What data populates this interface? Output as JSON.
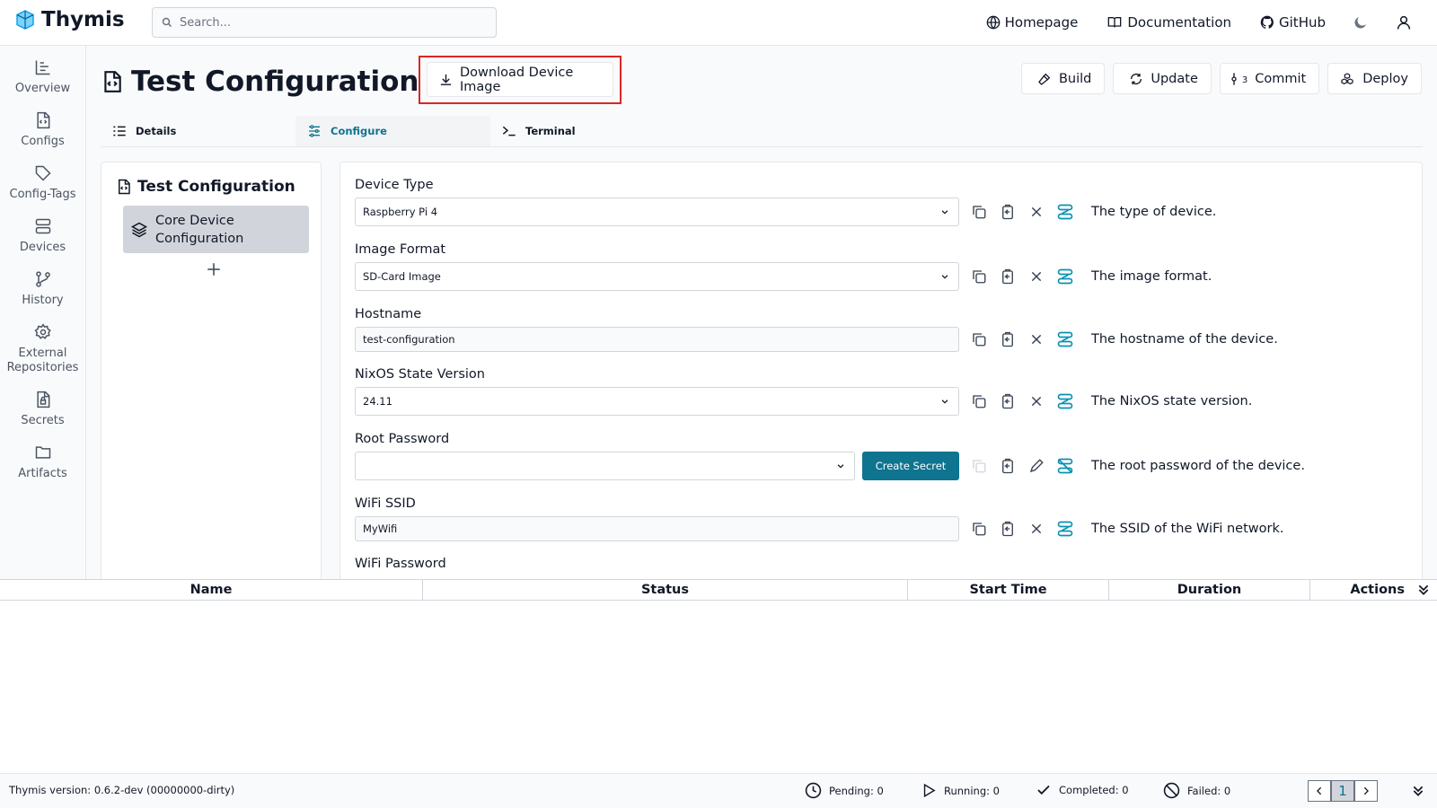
{
  "app": {
    "name": "Thymis"
  },
  "search": {
    "placeholder": "Search..."
  },
  "toplinks": {
    "homepage": "Homepage",
    "documentation": "Documentation",
    "github": "GitHub"
  },
  "sidebar": {
    "items": [
      {
        "label": "Overview",
        "icon": "bar-chart-icon"
      },
      {
        "label": "Configs",
        "icon": "file-code-icon"
      },
      {
        "label": "Config-Tags",
        "icon": "tag-icon"
      },
      {
        "label": "Devices",
        "icon": "server-icon"
      },
      {
        "label": "History",
        "icon": "git-branch-icon"
      },
      {
        "label": "External Repositories",
        "icon": "gear-icon"
      },
      {
        "label": "Secrets",
        "icon": "file-lock-icon"
      },
      {
        "label": "Artifacts",
        "icon": "folder-icon"
      }
    ]
  },
  "page": {
    "title": "Test Configuration",
    "download_label": "Download Device Image"
  },
  "actions": {
    "build": "Build",
    "update": "Update",
    "commit": "Commit",
    "commit_count": "3",
    "deploy": "Deploy"
  },
  "tabs": [
    {
      "label": "Details",
      "active": false
    },
    {
      "label": "Configure",
      "active": true
    },
    {
      "label": "Terminal",
      "active": false
    }
  ],
  "left_panel": {
    "title": "Test Configuration",
    "module": "Core Device Configuration"
  },
  "fields": [
    {
      "label": "Device Type",
      "value": "Raspberry Pi 4",
      "kind": "select",
      "description": "The type of device."
    },
    {
      "label": "Image Format",
      "value": "SD-Card Image",
      "kind": "select",
      "description": "The image format."
    },
    {
      "label": "Hostname",
      "value": "test-configuration",
      "kind": "text",
      "description": "The hostname of the device."
    },
    {
      "label": "NixOS State Version",
      "value": "24.11",
      "kind": "select",
      "description": "The NixOS state version."
    },
    {
      "label": "Root Password",
      "value": "",
      "kind": "secret",
      "button": "Create Secret",
      "description": "The root password of the device."
    },
    {
      "label": "WiFi SSID",
      "value": "MyWifi",
      "kind": "text",
      "description": "The SSID of the WiFi network."
    },
    {
      "label": "WiFi Password",
      "value": "",
      "kind": "secret",
      "description": ""
    }
  ],
  "task_table": {
    "columns": [
      "Name",
      "Status",
      "Start Time",
      "Duration",
      "Actions"
    ]
  },
  "footer": {
    "version": "Thymis version: 0.6.2-dev (00000000-dirty)",
    "pending": "Pending: 0",
    "running": "Running: 0",
    "completed": "Completed: 0",
    "failed": "Failed: 0",
    "page": "1"
  },
  "colors": {
    "accent": "#0e7490",
    "highlight": "#dc2626",
    "logo": "#38bdf8"
  }
}
